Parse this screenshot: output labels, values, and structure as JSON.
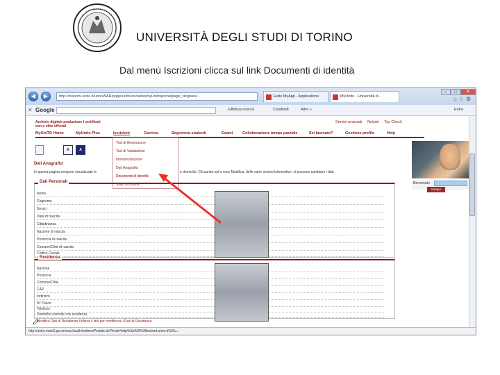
{
  "slide": {
    "title": "UNIVERSITÀ DEGLI STUDI DI TORINO",
    "subtitle": "Dal menù Iscrizioni clicca sul link Documenti di identità"
  },
  "browser": {
    "url": "http://testerni.unito.it/unitoWAR/page/unito/en/unito/myUnito/portal/page_degrees/...",
    "tabs": [
      "Esito MyApp - Applications",
      "MyUnito - Università d..."
    ],
    "google_search_label": "Google",
    "toolbar_items": [
      "Effettua ricerca",
      "Condividi",
      "Altro »"
    ],
    "right_label": "Entra",
    "status_url": "http://unito.esse3.pp.cineca.it/auth/redirectPortale.do?hostr=http%3a%2f%2ftestsmt.unito.it%2fu..."
  },
  "site": {
    "logo_text": "Archivio digitale produzione I certificati con o oltre ufficiali",
    "top_links": [
      "Servizi avanzati",
      "Notizie",
      "Tay Check"
    ],
    "menu": [
      {
        "label": "MyUniTO Home",
        "active": false
      },
      {
        "label": "MyUnito Plus",
        "active": false
      },
      {
        "label": "Iscrizioni",
        "active": true
      },
      {
        "label": "Carriera",
        "active": false
      },
      {
        "label": "Segreteria studenti",
        "active": false
      },
      {
        "label": "Esami",
        "active": false
      },
      {
        "label": "Collaborazione tempo parziale",
        "active": false
      },
      {
        "label": "Sei laureato?",
        "active": false
      },
      {
        "label": "Gestione profilo",
        "active": false
      },
      {
        "label": "Help",
        "active": false
      }
    ],
    "dropdown": [
      "Test di Ammissione",
      "Test di Valutazione",
      "Immatricolazione",
      "Dati Anagrafici",
      "Documenti di identità",
      "Stato iscrizione"
    ],
    "section_title": "Dati Anagrafici",
    "intro_left": "In questa pagina vengono visualizzate le",
    "intro_right": "e domicilio. Cliccando sul a voce Modifica, delle varie sezioni informative, si possono cambiare i dati.",
    "welcome_label": "Benvenuto",
    "logout_label": "Esegui",
    "personal": {
      "legend": "Dati Personali",
      "fields": [
        "Nome",
        "Cognome",
        "Sesso",
        "Data di nascita",
        "Cittadinanza",
        "Nazione di nascita",
        "Provincia di nascita",
        "Comune/Città di nascita",
        "Codice Fiscale"
      ]
    },
    "residence": {
      "legend": "Residenza",
      "fields": [
        "Nazione",
        "Provincia",
        "Comune/Città",
        "CAP",
        "Indirizzo",
        "N° Civico",
        "Telefono",
        "Domicilio coincide con residenza"
      ]
    },
    "bottom_link": "Modifica Dati di Residenza Utilizza il link per modificare i Dati di Residenza"
  },
  "colors": {
    "accent": "#8b1a1a",
    "arrow": "#e8312a"
  }
}
